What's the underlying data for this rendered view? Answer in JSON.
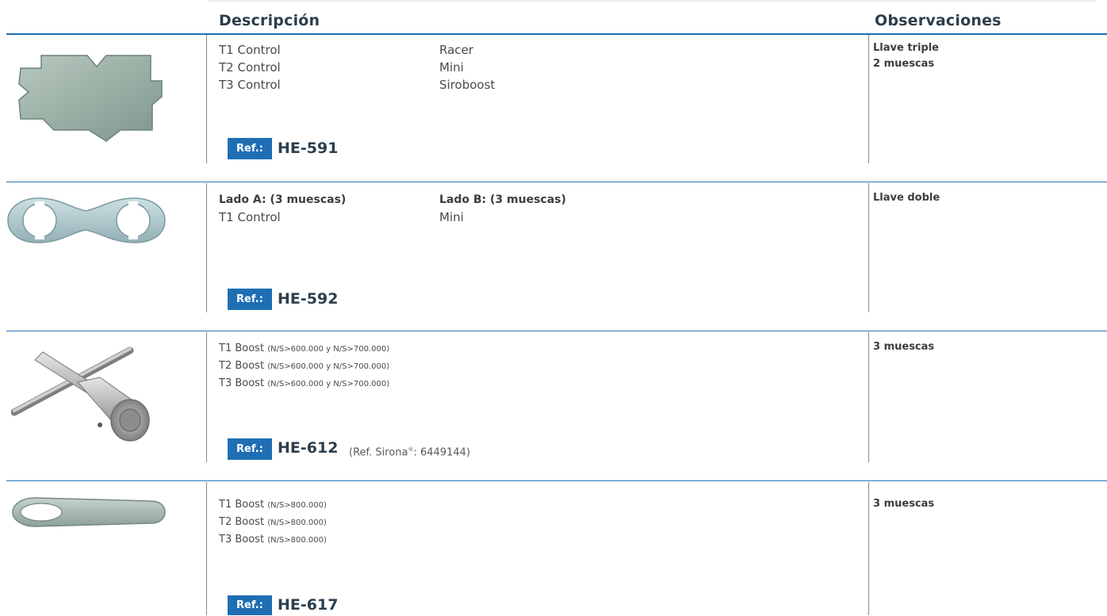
{
  "header": {
    "description_label": "Descripción",
    "observations_label": "Observaciones"
  },
  "products": [
    {
      "image_icon": "triple-key-icon",
      "col1": [
        "T1 Control",
        "T2 Control",
        "T3 Control"
      ],
      "col2": [
        "Racer",
        "Mini",
        "Siroboost"
      ],
      "ref_label": "Ref.:",
      "ref_code": "HE-591",
      "observations": [
        "Llave triple",
        "2 muescas"
      ]
    },
    {
      "image_icon": "double-key-icon",
      "col1_header": "Lado A: (3 muescas)",
      "col1": [
        "T1 Control"
      ],
      "col2_header": "Lado B: (3 muescas)",
      "col2": [
        "Mini"
      ],
      "ref_label": "Ref.:",
      "ref_code": "HE-592",
      "observations": [
        "Llave doble"
      ]
    },
    {
      "image_icon": "t-handle-key-icon",
      "lines": [
        {
          "model": "T1 Boost",
          "note": "(N/S>600.000 y N/S>700.000)"
        },
        {
          "model": "T2 Boost",
          "note": "(N/S>600.000 y N/S>700.000)"
        },
        {
          "model": "T3 Boost",
          "note": "(N/S>600.000 y N/S>700.000)"
        }
      ],
      "ref_label": "Ref.:",
      "ref_code": "HE-612",
      "alt_ref_prefix": "(Ref. Sirona",
      "alt_ref_mark": "®",
      "alt_ref_suffix": ": 6449144)",
      "observations": [
        "3 muescas"
      ]
    },
    {
      "image_icon": "flat-key-icon",
      "lines": [
        {
          "model": "T1 Boost",
          "note": "(N/S>800.000)"
        },
        {
          "model": "T2 Boost",
          "note": "(N/S>800.000)"
        },
        {
          "model": "T3 Boost",
          "note": "(N/S>800.000)"
        }
      ],
      "ref_label": "Ref.:",
      "ref_code": "HE-617",
      "observations": [
        "3 muescas"
      ]
    }
  ]
}
